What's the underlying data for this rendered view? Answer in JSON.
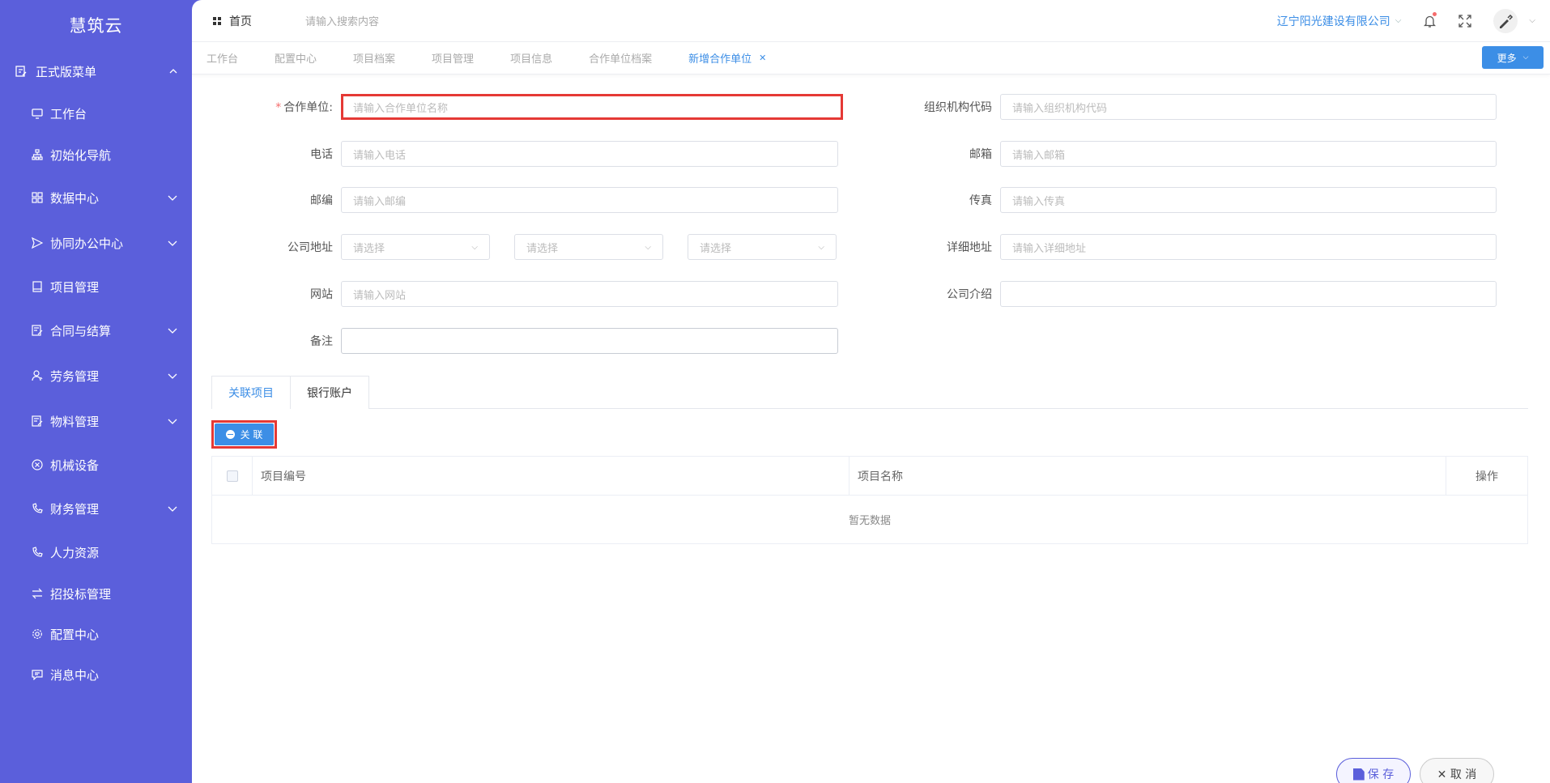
{
  "app": {
    "logo": "慧筑云"
  },
  "sidebar": {
    "group": {
      "label": "正式版菜单",
      "icon": "menu-doc-icon"
    },
    "items": [
      {
        "label": "工作台",
        "icon": "monitor-icon",
        "expandable": false
      },
      {
        "label": "初始化导航",
        "icon": "sitemap-icon",
        "expandable": false
      },
      {
        "label": "数据中心",
        "icon": "grid-icon",
        "expandable": true
      },
      {
        "label": "协同办公中心",
        "icon": "send-icon",
        "expandable": true
      },
      {
        "label": "项目管理",
        "icon": "book-icon",
        "expandable": false
      },
      {
        "label": "合同与结算",
        "icon": "edit-doc-icon",
        "expandable": true
      },
      {
        "label": "劳务管理",
        "icon": "worker-icon",
        "expandable": true
      },
      {
        "label": "物料管理",
        "icon": "edit-doc-icon",
        "expandable": true
      },
      {
        "label": "机械设备",
        "icon": "circle-x-icon",
        "expandable": false
      },
      {
        "label": "财务管理",
        "icon": "phone-icon",
        "expandable": true
      },
      {
        "label": "人力资源",
        "icon": "phone-icon",
        "expandable": false
      },
      {
        "label": "招投标管理",
        "icon": "exchange-icon",
        "expandable": false
      },
      {
        "label": "配置中心",
        "icon": "gear-icon",
        "expandable": false
      },
      {
        "label": "消息中心",
        "icon": "chat-icon",
        "expandable": false
      }
    ]
  },
  "topbar": {
    "home_label": "首页",
    "search_placeholder": "请输入搜索内容",
    "company": "辽宁阳光建设有限公司"
  },
  "tabs": {
    "items": [
      "工作台",
      "配置中心",
      "项目档案",
      "项目管理",
      "项目信息",
      "合作单位档案"
    ],
    "active": "新增合作单位",
    "more_label": "更多"
  },
  "form": {
    "partner": {
      "label": "合作单位:",
      "placeholder": "请输入合作单位名称"
    },
    "org_code": {
      "label": "组织机构代码",
      "placeholder": "请输入组织机构代码"
    },
    "phone": {
      "label": "电话",
      "placeholder": "请输入电话"
    },
    "email": {
      "label": "邮箱",
      "placeholder": "请输入邮箱"
    },
    "zip": {
      "label": "邮编",
      "placeholder": "请输入邮编"
    },
    "fax": {
      "label": "传真",
      "placeholder": "请输入传真"
    },
    "address": {
      "label": "公司地址",
      "select1": "请选择",
      "select2": "请选择",
      "select3": "请选择"
    },
    "detail_address": {
      "label": "详细地址",
      "placeholder": "请输入详细地址"
    },
    "website": {
      "label": "网站",
      "placeholder": "请输入网站"
    },
    "intro": {
      "label": "公司介绍",
      "placeholder": ""
    },
    "remark": {
      "label": "备注",
      "placeholder": ""
    }
  },
  "sub_tabs": {
    "active": "关联项目",
    "other": "银行账户"
  },
  "associate_label": "关 联",
  "table": {
    "columns": [
      "项目编号",
      "项目名称",
      "操作"
    ],
    "empty_text": "暂无数据"
  },
  "footer": {
    "save_label": "保 存",
    "cancel_label": "✕ 取 消"
  },
  "colors": {
    "sidebar": "#5b5fdb",
    "accent": "#3c8ee6",
    "error": "#e53935"
  }
}
